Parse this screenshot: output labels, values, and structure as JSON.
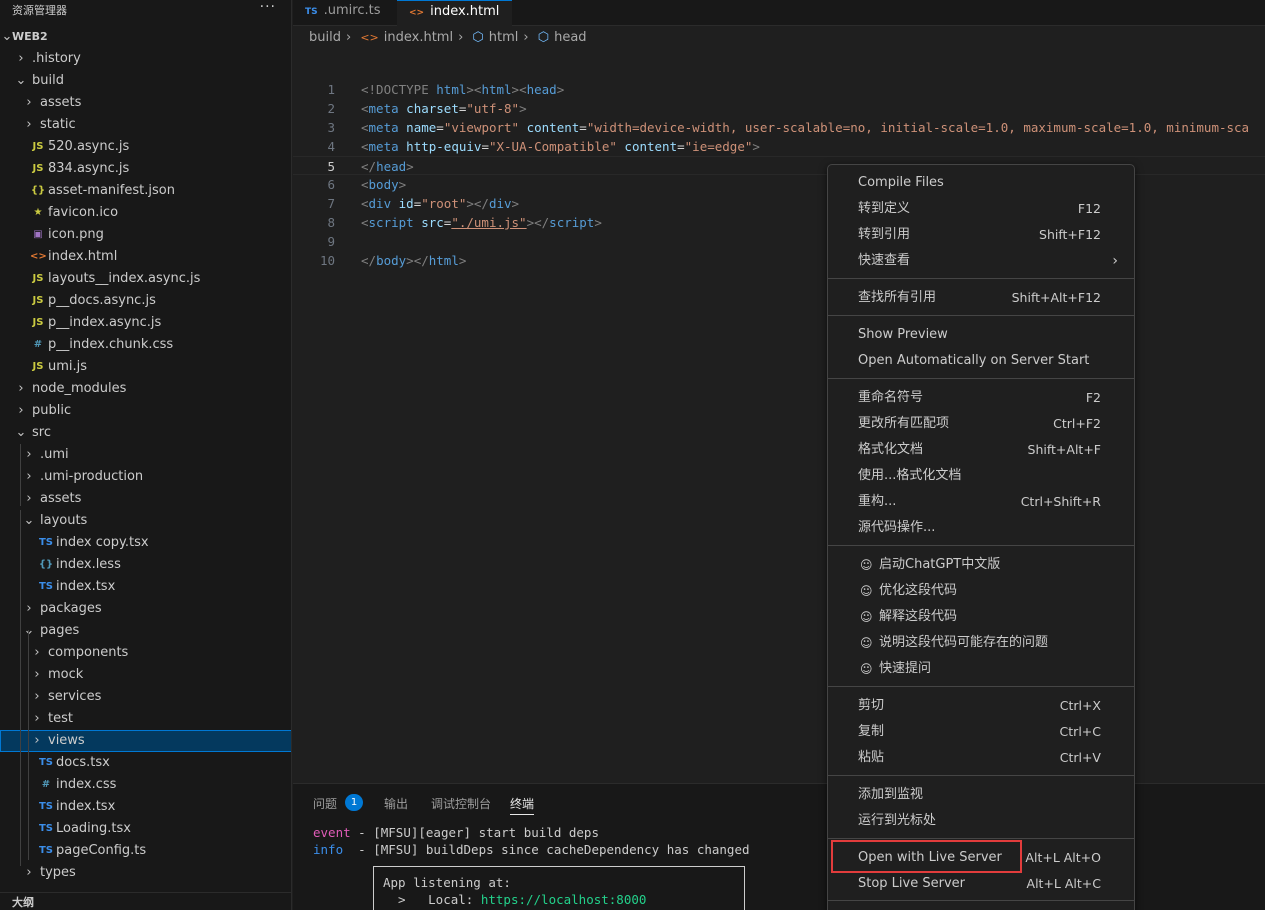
{
  "sidebar": {
    "title": "资源管理器",
    "more_label": "···",
    "root": "WEB2",
    "outline_label": "大纲",
    "items": [
      {
        "label": ".history",
        "type": "folder",
        "open": false
      },
      {
        "label": "build",
        "type": "folder",
        "open": true
      },
      {
        "label": "assets",
        "type": "folder",
        "open": false
      },
      {
        "label": "static",
        "type": "folder",
        "open": false
      },
      {
        "label": "520.async.js",
        "type": "js"
      },
      {
        "label": "834.async.js",
        "type": "js"
      },
      {
        "label": "asset-manifest.json",
        "type": "json"
      },
      {
        "label": "favicon.ico",
        "type": "ico"
      },
      {
        "label": "icon.png",
        "type": "png"
      },
      {
        "label": "index.html",
        "type": "html"
      },
      {
        "label": "layouts__index.async.js",
        "type": "js"
      },
      {
        "label": "p__docs.async.js",
        "type": "js"
      },
      {
        "label": "p__index.async.js",
        "type": "js"
      },
      {
        "label": "p__index.chunk.css",
        "type": "css"
      },
      {
        "label": "umi.js",
        "type": "js"
      },
      {
        "label": "node_modules",
        "type": "folder",
        "open": false
      },
      {
        "label": "public",
        "type": "folder",
        "open": false
      },
      {
        "label": "src",
        "type": "folder",
        "open": true
      },
      {
        "label": ".umi",
        "type": "folder",
        "open": false
      },
      {
        "label": ".umi-production",
        "type": "folder",
        "open": false
      },
      {
        "label": "assets",
        "type": "folder",
        "open": false
      },
      {
        "label": "layouts",
        "type": "folder",
        "open": true
      },
      {
        "label": "index copy.tsx",
        "type": "ts"
      },
      {
        "label": "index.less",
        "type": "less"
      },
      {
        "label": "index.tsx",
        "type": "ts"
      },
      {
        "label": "packages",
        "type": "folder",
        "open": false
      },
      {
        "label": "pages",
        "type": "folder",
        "open": true
      },
      {
        "label": "components",
        "type": "folder",
        "open": false
      },
      {
        "label": "mock",
        "type": "folder",
        "open": false
      },
      {
        "label": "services",
        "type": "folder",
        "open": false
      },
      {
        "label": "test",
        "type": "folder",
        "open": false
      },
      {
        "label": "views",
        "type": "folder",
        "open": false,
        "selected": true
      },
      {
        "label": "docs.tsx",
        "type": "ts"
      },
      {
        "label": "index.css",
        "type": "css"
      },
      {
        "label": "index.tsx",
        "type": "ts"
      },
      {
        "label": "Loading.tsx",
        "type": "ts"
      },
      {
        "label": "pageConfig.ts",
        "type": "ts"
      },
      {
        "label": "types",
        "type": "folder",
        "open": false
      }
    ]
  },
  "tabs": [
    {
      "label": ".umirc.ts",
      "icon": "TS",
      "active": false
    },
    {
      "label": "index.html",
      "icon": "<>",
      "active": true
    }
  ],
  "breadcrumb": [
    "build",
    "index.html",
    "html",
    "head"
  ],
  "code_lines": [
    [
      [
        "<!DOCTYPE ",
        "t-punct"
      ],
      [
        "html",
        "t-tag"
      ],
      [
        "><",
        "t-punct"
      ],
      [
        "html",
        "t-tag"
      ],
      [
        "><",
        "t-punct"
      ],
      [
        "head",
        "t-tag"
      ],
      [
        ">",
        "t-punct"
      ]
    ],
    [
      [
        "<",
        "t-punct"
      ],
      [
        "meta",
        "t-tag"
      ],
      [
        " charset",
        "t-attr"
      ],
      [
        "=",
        "t-eq"
      ],
      [
        "\"utf-8\"",
        "t-str"
      ],
      [
        ">",
        "t-punct"
      ]
    ],
    [
      [
        "<",
        "t-punct"
      ],
      [
        "meta",
        "t-tag"
      ],
      [
        " name",
        "t-attr"
      ],
      [
        "=",
        "t-eq"
      ],
      [
        "\"viewport\"",
        "t-str"
      ],
      [
        " content",
        "t-attr"
      ],
      [
        "=",
        "t-eq"
      ],
      [
        "\"width=device-width, user-scalable=no, initial-scale=1.0, maximum-scale=1.0, minimum-sca",
        "t-str"
      ]
    ],
    [
      [
        "<",
        "t-punct"
      ],
      [
        "meta",
        "t-tag"
      ],
      [
        " http-equiv",
        "t-attr"
      ],
      [
        "=",
        "t-eq"
      ],
      [
        "\"X-UA-Compatible\"",
        "t-str"
      ],
      [
        " content",
        "t-attr"
      ],
      [
        "=",
        "t-eq"
      ],
      [
        "\"ie=edge\"",
        "t-str"
      ],
      [
        ">",
        "t-punct"
      ]
    ],
    [
      [
        "</",
        "t-punct"
      ],
      [
        "head",
        "t-tag"
      ],
      [
        ">",
        "t-punct"
      ]
    ],
    [
      [
        "<",
        "t-punct"
      ],
      [
        "body",
        "t-tag"
      ],
      [
        ">",
        "t-punct"
      ]
    ],
    [
      [
        "<",
        "t-punct"
      ],
      [
        "div",
        "t-tag"
      ],
      [
        " id",
        "t-attr"
      ],
      [
        "=",
        "t-eq"
      ],
      [
        "\"root\"",
        "t-str"
      ],
      [
        "></",
        "t-punct"
      ],
      [
        "div",
        "t-tag"
      ],
      [
        ">",
        "t-punct"
      ]
    ],
    [
      [
        "<",
        "t-punct"
      ],
      [
        "script",
        "t-tag"
      ],
      [
        " src",
        "t-attr"
      ],
      [
        "=",
        "t-eq"
      ],
      [
        "\"./umi.js\"",
        "t-str"
      ],
      [
        "></",
        "t-punct"
      ],
      [
        "script",
        "t-tag"
      ],
      [
        ">",
        "t-punct"
      ]
    ],
    [],
    [
      [
        "</",
        "t-punct"
      ],
      [
        "body",
        "t-tag"
      ],
      [
        "></",
        "t-punct"
      ],
      [
        "html",
        "t-tag"
      ],
      [
        ">",
        "t-punct"
      ]
    ]
  ],
  "current_line": 5,
  "panel": {
    "tabs": [
      "问题",
      "输出",
      "调试控制台",
      "终端"
    ],
    "problems_count": "1",
    "active_tab": "终端",
    "terminal": [
      {
        "k": "event",
        "cls": "tk-event",
        "t": " - [MFSU][eager] start build deps"
      },
      {
        "k": "info ",
        "cls": "tk-info",
        "t": " - [MFSU] buildDeps since cacheDependency has changed"
      }
    ],
    "listen_title": "App listening at:",
    "listen_local_label": "  >   Local: ",
    "listen_local_url": "https://localhost:8000"
  },
  "context_menu": {
    "groups": [
      [
        {
          "label": "Compile Files",
          "key": ""
        },
        {
          "label": "转到定义",
          "key": "F12"
        },
        {
          "label": "转到引用",
          "key": "Shift+F12"
        },
        {
          "label": "快速查看",
          "key": "",
          "submenu": true
        }
      ],
      [
        {
          "label": "查找所有引用",
          "key": "Shift+Alt+F12"
        }
      ],
      [
        {
          "label": "Show Preview",
          "key": ""
        },
        {
          "label": "Open Automatically on Server Start",
          "key": ""
        }
      ],
      [
        {
          "label": "重命名符号",
          "key": "F2"
        },
        {
          "label": "更改所有匹配项",
          "key": "Ctrl+F2"
        },
        {
          "label": "格式化文档",
          "key": "Shift+Alt+F"
        },
        {
          "label": "使用...格式化文档",
          "key": ""
        },
        {
          "label": "重构...",
          "key": "Ctrl+Shift+R"
        },
        {
          "label": "源代码操作...",
          "key": ""
        }
      ],
      [
        {
          "label": "启动ChatGPT中文版",
          "key": "",
          "gpt": true
        },
        {
          "label": "优化这段代码",
          "key": "",
          "gpt": true
        },
        {
          "label": "解释这段代码",
          "key": "",
          "gpt": true
        },
        {
          "label": "说明这段代码可能存在的问题",
          "key": "",
          "gpt": true
        },
        {
          "label": "快速提问",
          "key": "",
          "gpt": true
        }
      ],
      [
        {
          "label": "剪切",
          "key": "Ctrl+X"
        },
        {
          "label": "复制",
          "key": "Ctrl+C"
        },
        {
          "label": "粘贴",
          "key": "Ctrl+V"
        }
      ],
      [
        {
          "label": "添加到监视",
          "key": ""
        },
        {
          "label": "运行到光标处",
          "key": ""
        }
      ],
      [
        {
          "label": "Open with Live Server",
          "key": "Alt+L Alt+O",
          "highlighted": true
        },
        {
          "label": "Stop Live Server",
          "key": "Alt+L Alt+C"
        }
      ]
    ]
  },
  "colors": {
    "accent": "#0078d4",
    "highlight_border": "#e23c3c",
    "ts_icon": "#3b8eea",
    "js_icon": "#cbcb41",
    "html_icon": "#e37933",
    "css_icon": "#519aba",
    "json_icon": "#cbcb41",
    "png_icon": "#a074c4",
    "ico_icon": "#cbcb41"
  }
}
